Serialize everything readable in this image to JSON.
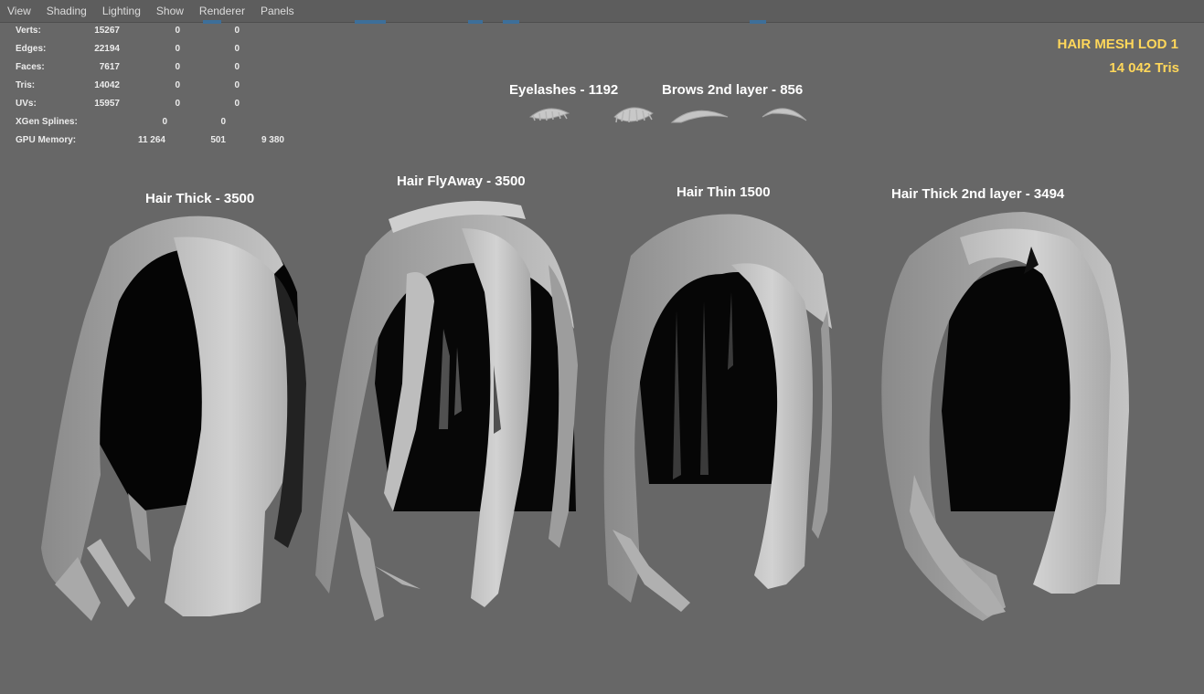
{
  "menu": {
    "items": [
      "View",
      "Shading",
      "Lighting",
      "Show",
      "Renderer",
      "Panels"
    ]
  },
  "hud": {
    "rows": [
      {
        "label": "Verts:",
        "v1": "15267",
        "v2": "0",
        "v3": "0"
      },
      {
        "label": "Edges:",
        "v1": "22194",
        "v2": "0",
        "v3": "0"
      },
      {
        "label": "Faces:",
        "v1": "7617",
        "v2": "0",
        "v3": "0"
      },
      {
        "label": "Tris:",
        "v1": "14042",
        "v2": "0",
        "v3": "0"
      },
      {
        "label": "UVs:",
        "v1": "15957",
        "v2": "0",
        "v3": "0"
      }
    ],
    "xgen": {
      "label": "XGen Splines:",
      "v1": "0",
      "v2": "0"
    },
    "gpu": {
      "label": "GPU Memory:",
      "v1": "11 264",
      "v2": "501",
      "v3": "9 380"
    }
  },
  "lod": {
    "title": "HAIR MESH LOD 1",
    "tris": "14 042 Tris",
    "color": "#ffd75a"
  },
  "captions": {
    "eyelashes": "Eyelashes - 1192",
    "brows": "Brows 2nd layer - 856",
    "hair_thick": "Hair Thick - 3500",
    "hair_flyaway": "Hair FlyAway - 3500",
    "hair_thin": "Hair Thin 1500",
    "hair_thick_2nd": "Hair Thick 2nd layer - 3494"
  },
  "colors": {
    "viewport_bg": "#676767",
    "mesh_light": "#c9c9c9",
    "mesh_shadow": "#050505"
  }
}
